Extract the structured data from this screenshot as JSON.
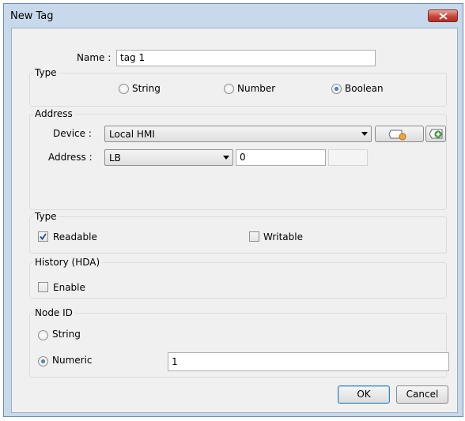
{
  "window": {
    "title": "New Tag"
  },
  "name_field": {
    "label": "Name :",
    "value": "tag 1"
  },
  "type_group": {
    "legend": "Type",
    "options": [
      "String",
      "Number",
      "Boolean"
    ],
    "selected": "Boolean"
  },
  "address_group": {
    "legend": "Address",
    "device_label": "Device :",
    "device_value": "Local HMI",
    "address_label": "Address :",
    "address_select_value": "LB",
    "address_value": "0"
  },
  "access_group": {
    "legend": "Type",
    "readable_label": "Readable",
    "readable_checked": true,
    "writable_label": "Writable",
    "writable_checked": false
  },
  "history_group": {
    "legend": "History (HDA)",
    "enable_label": "Enable",
    "enable_checked": false
  },
  "node_group": {
    "legend": "Node ID",
    "string_label": "String",
    "numeric_label": "Numeric",
    "selected": "Numeric",
    "numeric_value": "1"
  },
  "buttons": {
    "ok": "OK",
    "cancel": "Cancel"
  },
  "colors": {
    "title_bar": "#c8d9ec",
    "close": "#c9453a",
    "client": "#f0f0f0",
    "check": "#1d4e8f"
  }
}
